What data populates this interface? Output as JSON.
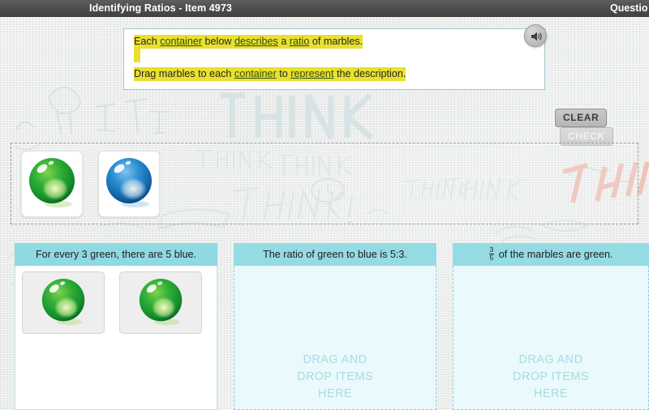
{
  "titlebar": {
    "title": "Identifying Ratios - Item 4973",
    "right_label": "Questio"
  },
  "instruction": {
    "line1_prefix": "Each ",
    "line1_link1": "container",
    "line1_mid1": " below ",
    "line1_link2": "describes",
    "line1_mid2": " a ",
    "line1_link3": "ratio",
    "line1_suffix": " of marbles.",
    "line2_prefix": "Drag marbles to each ",
    "line2_link1": "container",
    "line2_mid1": " to ",
    "line2_link2": "represent",
    "line2_suffix": " the description.",
    "audio_icon": "speaker-icon"
  },
  "actions": {
    "clear_label": "CLEAR",
    "check_label": "CHECK"
  },
  "source_tray": {
    "items": [
      {
        "name": "green-marble",
        "color": "#2aa32a"
      },
      {
        "name": "blue-marble",
        "color": "#1b7fc4"
      }
    ]
  },
  "containers": [
    {
      "id": "container-1",
      "header": "For every 3 green, there are 5 blue.",
      "placeholder": "",
      "dropped": [
        {
          "name": "green-marble",
          "color": "#2aa32a"
        },
        {
          "name": "green-marble",
          "color": "#2aa32a"
        }
      ]
    },
    {
      "id": "container-2",
      "header": "The ratio of green to blue is 5:3.",
      "placeholder_line1": "DRAG AND",
      "placeholder_line2": "DROP ITEMS",
      "placeholder_line3": "HERE",
      "dropped": []
    },
    {
      "id": "container-3",
      "header_fraction_numerator": "3",
      "header_fraction_denominator": "5",
      "header_text": " of the marbles are green.",
      "placeholder_line1": "DRAG AND",
      "placeholder_line2": "DROP ITEMS",
      "placeholder_line3": "HERE",
      "dropped": []
    }
  ],
  "background": {
    "graffiti_main": "THINK",
    "graffiti_accent": "THINK"
  },
  "colors": {
    "titlebar": "#4b4b4b",
    "highlight": "#e9e02f",
    "header_teal": "#95dbe4",
    "dropzone_bg": "#eaf9fb",
    "dropzone_border": "#86cfdc",
    "placeholder_text": "#a8dbe6"
  }
}
